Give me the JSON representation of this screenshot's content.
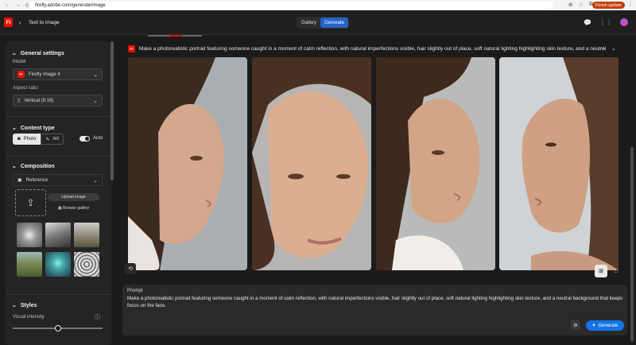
{
  "browser": {
    "url": "firefly.adobe.com/generate/image",
    "update_label": "Finish update"
  },
  "app": {
    "logo": "Fi",
    "title": "Text to image",
    "toggle": [
      "Gallery",
      "Generate"
    ]
  },
  "sidebar": {
    "general_settings": "General settings",
    "model_label": "Model",
    "model_value": "Firefly Image 4",
    "aspect_label": "Aspect ratio",
    "aspect_value": "Vertical (9:16)",
    "content_type": "Content type",
    "photo": "Photo",
    "art": "Art",
    "auto": "Auto",
    "composition": "Composition",
    "reference": "Reference",
    "upload": "Upload image",
    "browse": "Browse gallery",
    "styles": "Styles",
    "visual_intensity": "Visual intensity",
    "visual_intensity_level": 0.5
  },
  "main": {
    "prompt_heading": "Make a photorealistic portrait featuring someone caught in a moment of calm reflection, with natural imperfections visible, hair slightly out of place, soft natural lighting highlighting skin texture, and a neutral",
    "prompt_label": "Prompt",
    "prompt_text": "Make a photorealistic portrait featuring someone caught in a moment of calm reflection, with natural imperfections visible, hair slightly out of place, soft natural lighting highlighting skin texture, and a neutral background that keeps focus on the face.",
    "generate": "Generate"
  },
  "colors": {
    "accent": "#1473e6",
    "brand": "#eb1000"
  }
}
